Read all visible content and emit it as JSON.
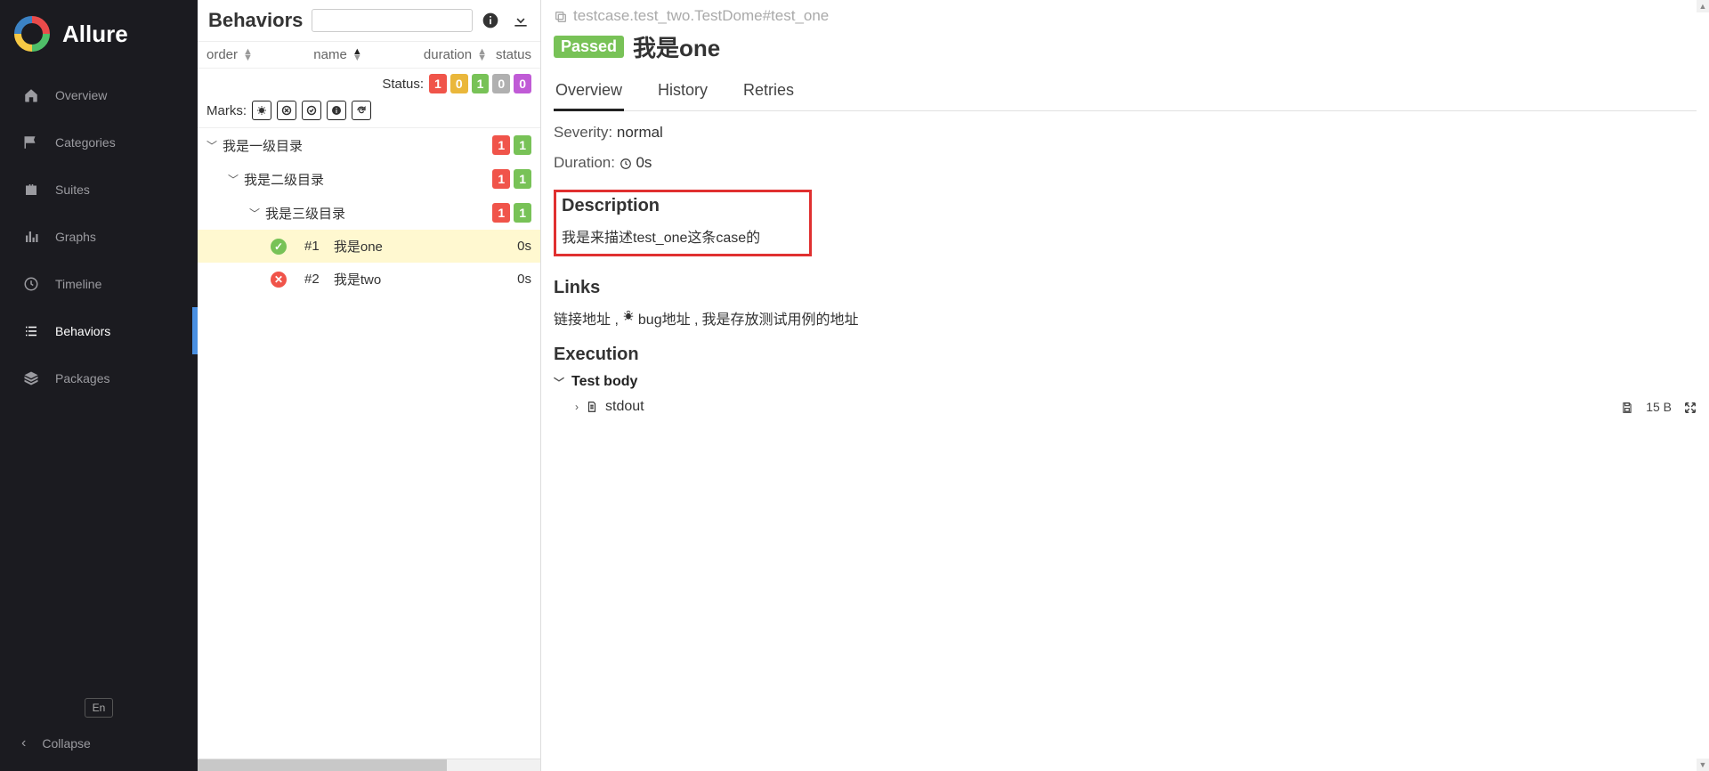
{
  "brand": {
    "name": "Allure"
  },
  "sidebar": {
    "items": [
      {
        "label": "Overview"
      },
      {
        "label": "Categories"
      },
      {
        "label": "Suites"
      },
      {
        "label": "Graphs"
      },
      {
        "label": "Timeline"
      },
      {
        "label": "Behaviors"
      },
      {
        "label": "Packages"
      }
    ],
    "lang": "En",
    "collapse": "Collapse"
  },
  "mid": {
    "title": "Behaviors",
    "search_placeholder": "",
    "columns": {
      "order": "order",
      "name": "name",
      "duration": "duration",
      "status": "status"
    },
    "status_label": "Status:",
    "status_counts": [
      "1",
      "0",
      "1",
      "0",
      "0"
    ],
    "marks_label": "Marks:",
    "tree": {
      "l1": {
        "label": "我是一级目录",
        "red": "1",
        "green": "1"
      },
      "l2": {
        "label": "我是二级目录",
        "red": "1",
        "green": "1"
      },
      "l3": {
        "label": "我是三级目录",
        "red": "1",
        "green": "1"
      },
      "leaves": [
        {
          "num": "#1",
          "name": "我是one",
          "dur": "0s",
          "status": "pass"
        },
        {
          "num": "#2",
          "name": "我是two",
          "dur": "0s",
          "status": "fail"
        }
      ]
    }
  },
  "right": {
    "path": "testcase.test_two.TestDome#test_one",
    "status": "Passed",
    "title": "我是one",
    "tabs": [
      "Overview",
      "History",
      "Retries"
    ],
    "severity_label": "Severity:",
    "severity_value": "normal",
    "duration_label": "Duration:",
    "duration_value": "0s",
    "description_heading": "Description",
    "description_text": "我是来描述test_one这条case的",
    "links_heading": "Links",
    "links_text_prefix": "链接地址 , ",
    "links_text_mid": " bug地址 , ",
    "links_text_suffix": "我是存放测试用例的地址",
    "execution_heading": "Execution",
    "testbody_label": "Test body",
    "stdout_label": "stdout",
    "stdout_size": "15 B"
  }
}
